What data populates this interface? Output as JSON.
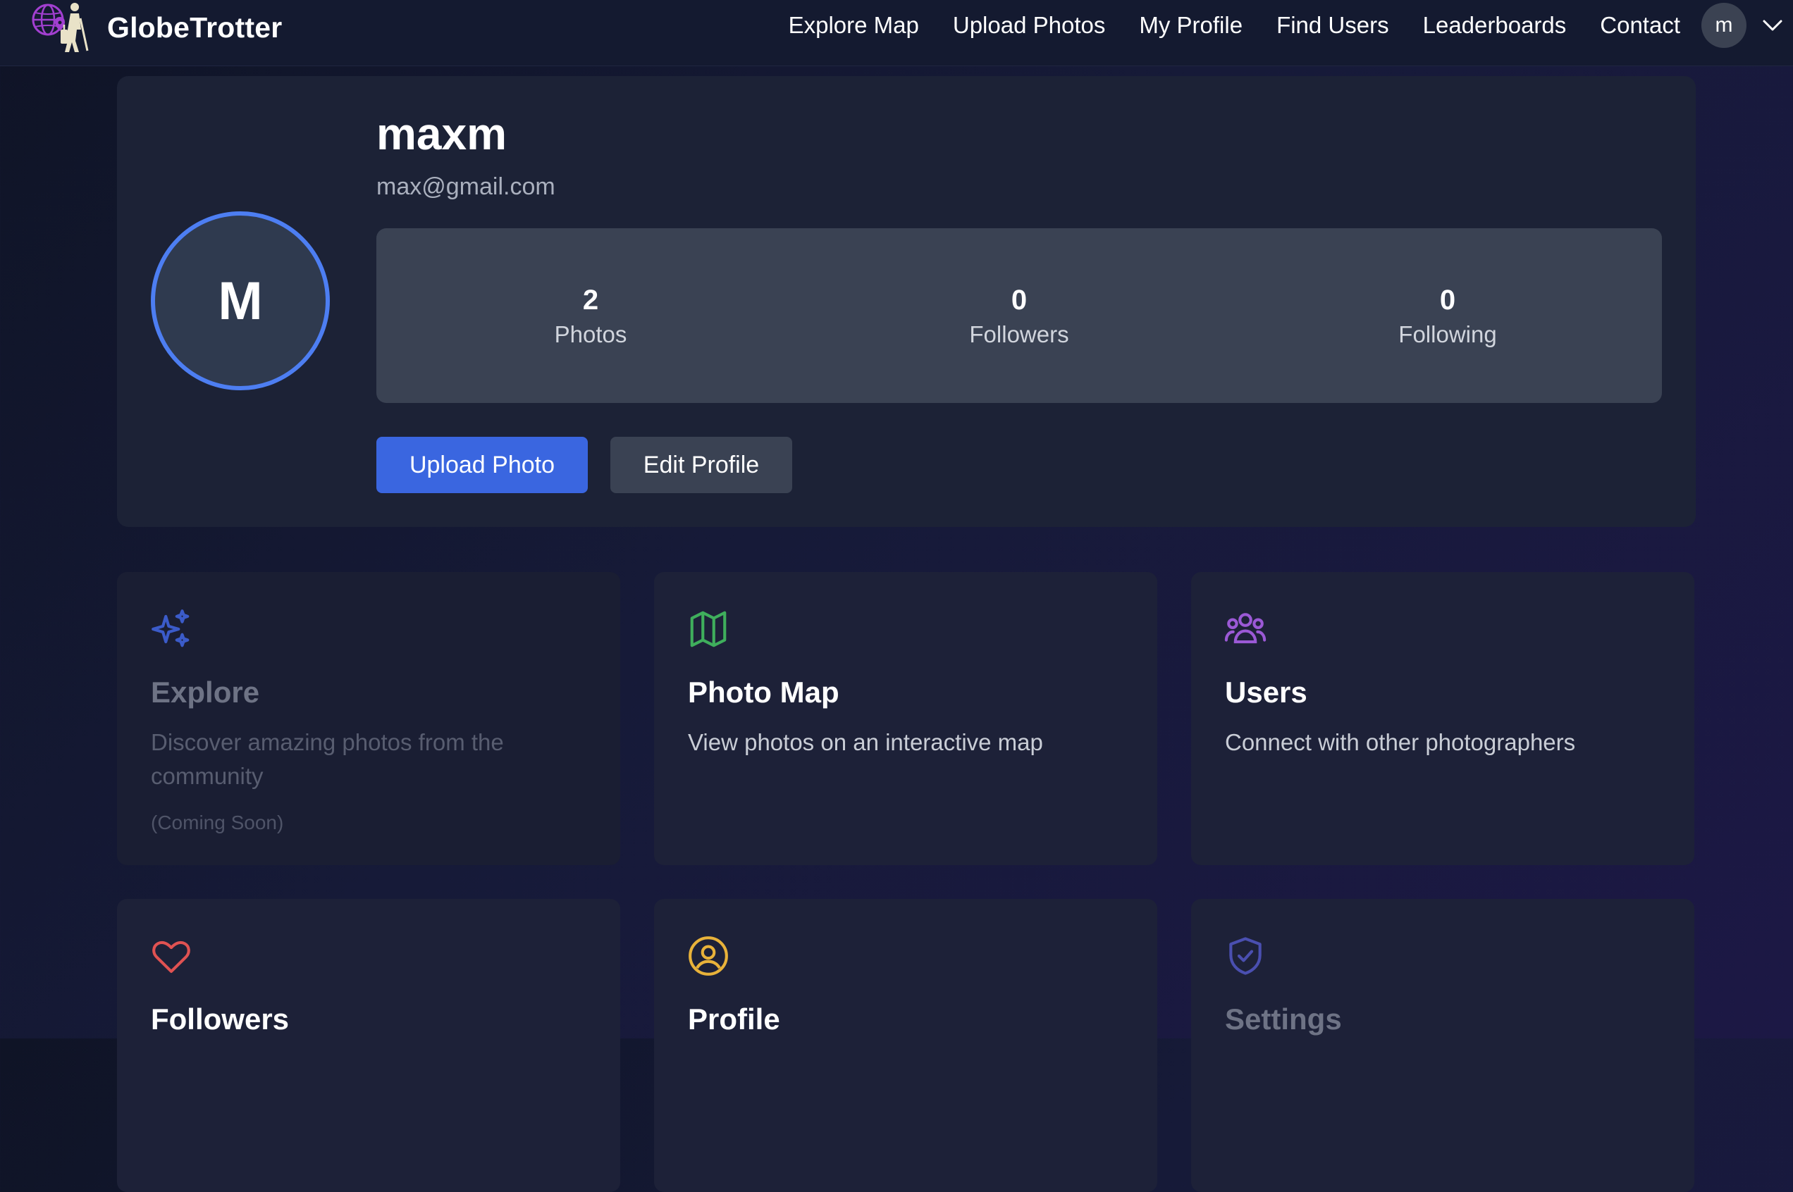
{
  "brand": {
    "name": "GlobeTrotter"
  },
  "nav": {
    "links": [
      "Explore Map",
      "Upload Photos",
      "My Profile",
      "Find Users",
      "Leaderboards",
      "Contact"
    ],
    "user_initial": "m"
  },
  "profile": {
    "avatar_letter": "M",
    "username": "maxm",
    "email": "max@gmail.com",
    "stats": [
      {
        "value": "2",
        "label": "Photos"
      },
      {
        "value": "0",
        "label": "Followers"
      },
      {
        "value": "0",
        "label": "Following"
      }
    ],
    "upload_button": "Upload Photo",
    "edit_button": "Edit Profile"
  },
  "cards": [
    {
      "title": "Explore",
      "desc": "Discover amazing photos from the community",
      "note": "(Coming Soon)",
      "icon": "sparkles-icon"
    },
    {
      "title": "Photo Map",
      "desc": "View photos on an interactive map",
      "icon": "map-icon"
    },
    {
      "title": "Users",
      "desc": "Connect with other photographers",
      "icon": "users-icon"
    },
    {
      "title": "Followers",
      "icon": "heart-icon"
    },
    {
      "title": "Profile",
      "icon": "user-circle-icon"
    },
    {
      "title": "Settings",
      "icon": "shield-check-icon"
    }
  ],
  "colors": {
    "accent": "#3a66e0",
    "avatar_ring": "#4d7ef2",
    "explore_icon": "#3b5bc9",
    "map_icon": "#3fae5c",
    "users_icon": "#9b59d6",
    "followers_icon": "#e05252",
    "profile_icon": "#e8b23a",
    "settings_icon": "#4a4fb0"
  }
}
